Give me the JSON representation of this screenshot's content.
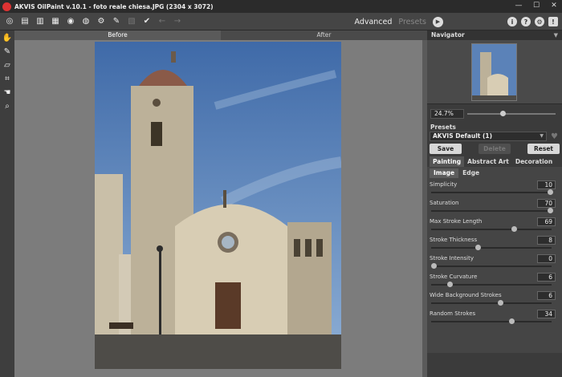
{
  "window": {
    "title": "AKVIS OilPaint v.10.1 - foto reale chiesa.JPG (2304 x 3072)"
  },
  "toolbar": {
    "icons": [
      "open-icon",
      "open-batch-icon",
      "save-icon",
      "print-icon",
      "share-icon",
      "plugins-icon",
      "settings-icon",
      "background-icon",
      "apply-icon",
      "undo-icon",
      "redo-icon"
    ],
    "mode_advanced": "Advanced",
    "mode_presets": "Presets",
    "right_icons": [
      "info-icon",
      "help-icon",
      "gear-icon",
      "notification-icon"
    ]
  },
  "tools": [
    "hand-brush-icon",
    "pencil-icon",
    "eraser-icon",
    "crop-icon",
    "hand-icon",
    "zoom-icon"
  ],
  "canvas": {
    "tab_before": "Before",
    "tab_after": "After",
    "sky_color": "#5b82b8",
    "accent": "#c8bea6"
  },
  "navigator": {
    "title": "Navigator",
    "zoom": "24.7%",
    "zoom_level": 0.4
  },
  "presets": {
    "label": "Presets",
    "selected": "AKVIS Default (1)",
    "save": "Save",
    "delete": "Delete",
    "reset": "Reset"
  },
  "categories": {
    "painting": "Painting",
    "abstract_art": "Abstract Art",
    "decoration": "Decoration"
  },
  "subtabs": {
    "image": "Image",
    "edge": "Edge"
  },
  "params": [
    {
      "label": "Simplicity",
      "value": "10",
      "level": 1.0
    },
    {
      "label": "Saturation",
      "value": "70",
      "level": 1.0
    },
    {
      "label": "Max Stroke Length",
      "value": "69",
      "level": 0.69
    },
    {
      "label": "Stroke Thickness",
      "value": "8",
      "level": 0.38
    },
    {
      "label": "Stroke Intensity",
      "value": "0",
      "level": 0.0
    },
    {
      "label": "Stroke Curvature",
      "value": "6",
      "level": 0.14
    },
    {
      "label": "Wide Background Strokes",
      "value": "6",
      "level": 0.57
    },
    {
      "label": "Random Strokes",
      "value": "34",
      "level": 0.67
    }
  ]
}
